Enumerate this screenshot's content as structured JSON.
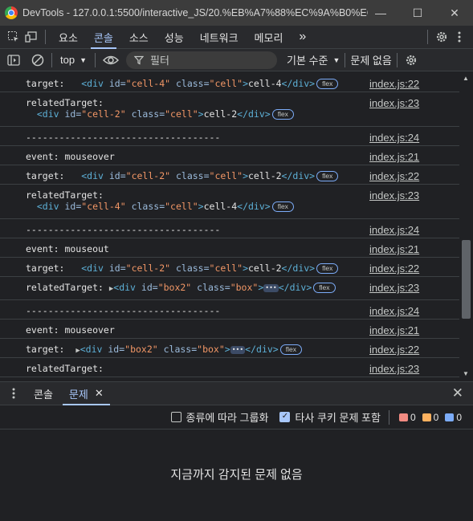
{
  "window": {
    "title": "DevTools - 127.0.0.1:5500/interactive_JS/20.%EB%A7%88%EC%9A%B0%EC%...",
    "minimize": "—",
    "maximize": "☐",
    "close": "✕"
  },
  "tabs": [
    "요소",
    "콘솔",
    "소스",
    "성능",
    "네트워크",
    "메모리"
  ],
  "active_tab": "콘솔",
  "more_tabs": "»",
  "toolbar": {
    "context": "top",
    "filter_placeholder": "필터",
    "level": "기본 수준",
    "issues": "문제 없음"
  },
  "console_rows": [
    {
      "type": "target",
      "label": "target:",
      "id": "cell-4",
      "cls": "cell",
      "text": "cell-4",
      "badge": "flex",
      "src": "index.js:22"
    },
    {
      "type": "related2",
      "label": "relatedTarget:",
      "id": "cell-2",
      "cls": "cell",
      "text": "cell-2",
      "badge": "flex",
      "src": "index.js:23"
    },
    {
      "type": "sep",
      "text": "-----------------------------------",
      "src": "index.js:24"
    },
    {
      "type": "event",
      "text": "event: mouseover",
      "src": "index.js:21"
    },
    {
      "type": "target",
      "label": "target:",
      "id": "cell-2",
      "cls": "cell",
      "text": "cell-2",
      "badge": "flex",
      "src": "index.js:22"
    },
    {
      "type": "related2",
      "label": "relatedTarget:",
      "id": "cell-4",
      "cls": "cell",
      "text": "cell-4",
      "badge": "flex",
      "src": "index.js:23"
    },
    {
      "type": "sep",
      "text": "-----------------------------------",
      "src": "index.js:24"
    },
    {
      "type": "event",
      "text": "event: mouseout",
      "src": "index.js:21"
    },
    {
      "type": "target",
      "label": "target:",
      "id": "cell-2",
      "cls": "cell",
      "text": "cell-2",
      "badge": "flex",
      "src": "index.js:22"
    },
    {
      "type": "relbox",
      "label": "relatedTarget:",
      "id": "box2",
      "cls": "box",
      "badge": "flex",
      "src": "index.js:23"
    },
    {
      "type": "sep",
      "text": "-----------------------------------",
      "src": "index.js:24"
    },
    {
      "type": "event",
      "text": "event: mouseover",
      "src": "index.js:21"
    },
    {
      "type": "targetbox",
      "label": "target:",
      "id": "box2",
      "cls": "box",
      "badge": "flex",
      "src": "index.js:22"
    },
    {
      "type": "partial",
      "label": "relatedTarget:",
      "src": "index.js:23"
    }
  ],
  "drawer": {
    "tabs": [
      "콘솔",
      "문제"
    ],
    "active_tab": "문제",
    "group_label": "종류에 따라 그룹화",
    "third_party_label": "타사 쿠키 문제 포함",
    "errors": "0",
    "warnings": "0",
    "infos": "0",
    "empty_message": "지금까지 감지된 문제 없음"
  },
  "colors": {
    "accent": "#a8c7fa",
    "tag": "#5db0d7",
    "attr_value": "#f29766"
  }
}
